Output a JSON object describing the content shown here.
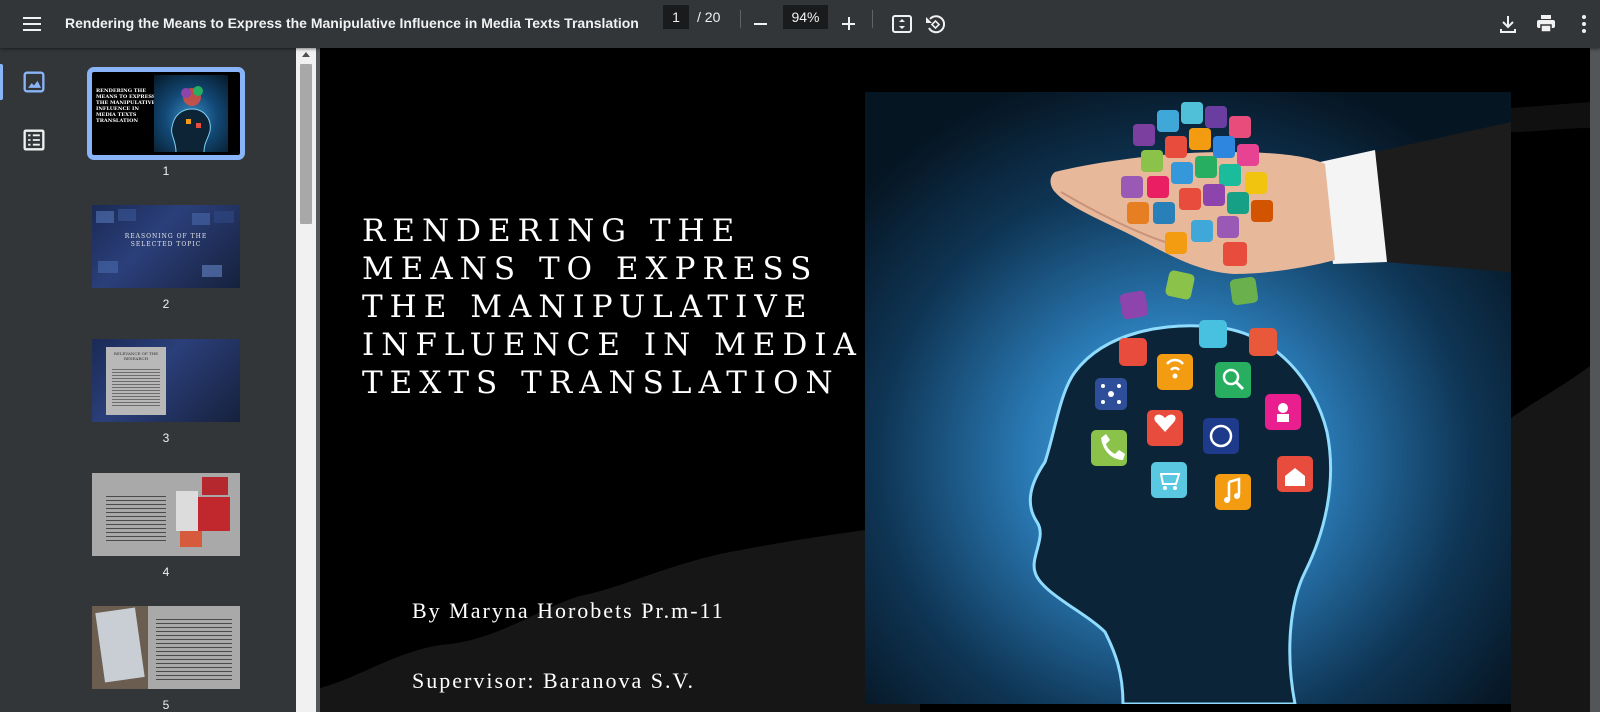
{
  "toolbar": {
    "menu_icon": "hamburger-menu-icon",
    "title": "Rendering the Means to Express the Manipulative Influence in Media Texts Translation",
    "current_page": "1",
    "total_pages": "/ 20",
    "zoom": "94%",
    "icons": [
      "fit-page-icon",
      "rotate-icon",
      "download-icon",
      "print-icon",
      "more-vert-icon"
    ]
  },
  "sidebar": {
    "icons": [
      "thumbnails-icon",
      "outline-icon"
    ],
    "thumbnails": [
      {
        "num": "1",
        "caption": "RENDERING THE MEANS TO EXPRESS THE MANIPULATIVE INFLUENCE IN MEDIA TEXTS TRANSLATION"
      },
      {
        "num": "2",
        "caption": "REASONING OF THE SELECTED TOPIC"
      },
      {
        "num": "3",
        "caption": "RELEVANCE OF THE RESEARCH"
      },
      {
        "num": "4",
        "caption": ""
      },
      {
        "num": "5",
        "caption": ""
      }
    ]
  },
  "slide": {
    "title": "Rendering the means to express the manipulative influence in media texts translation",
    "author": "By Maryna Horobets Pr.m-11",
    "supervisor": "Supervisor: Baranova S.V."
  },
  "colors": {
    "toolbar_bg": "#323639",
    "viewer_bg": "#525659",
    "accent": "#8ab4f8"
  }
}
